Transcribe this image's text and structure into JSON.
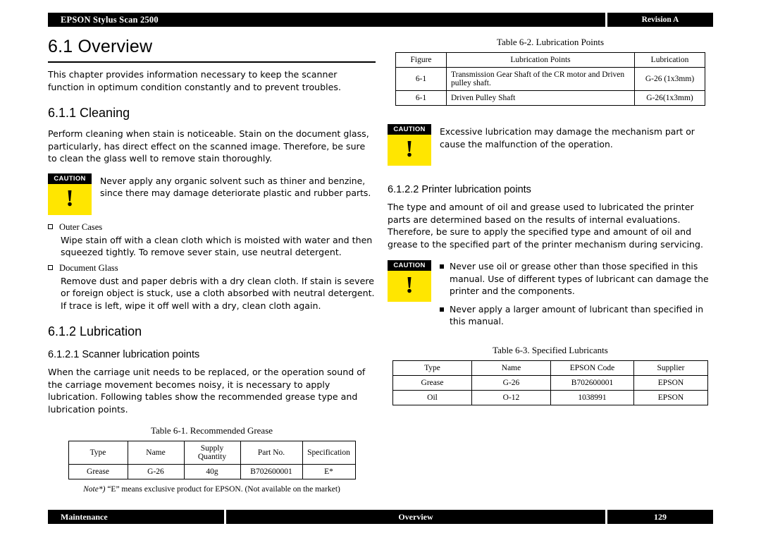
{
  "header": {
    "product": "EPSON Stylus Scan 2500",
    "revision": "Revision A"
  },
  "footer": {
    "left": "Maintenance",
    "center": "Overview",
    "page": "129"
  },
  "left_column": {
    "chapter_title": "6.1 Overview",
    "intro": "This chapter provides information necessary to keep the scanner function in optimum condition constantly and to prevent troubles.",
    "cleaning_heading": "6.1.1 Cleaning",
    "cleaning_body": "Perform cleaning when stain is noticeable. Stain on the document glass, particularly, has direct effect on the scanned image. Therefore, be sure to clean the glass well to remove stain thoroughly.",
    "caution_label": "CAUTION",
    "caution_text": "Never apply any organic solvent such as thiner and benzine, since there may damage deteriorate plastic and rubber parts.",
    "items": [
      {
        "title": "Outer Cases",
        "body": "Wipe stain off with a clean cloth which is moisted with water and then squeezed tightly. To remove sever stain, use neutral detergent."
      },
      {
        "title": "Document Glass",
        "body": "Remove dust and paper debris with a dry clean cloth. If stain is severe or foreign object is stuck, use a cloth absorbed with neutral detergent. If trace is left, wipe it off well with a dry, clean cloth again."
      }
    ],
    "lubrication_heading": "6.1.2 Lubrication",
    "scanner_lub_heading": "6.1.2.1 Scanner lubrication points",
    "scanner_lub_body": "When the carriage unit needs to be replaced, or the operation sound of the carriage movement becomes noisy, it is necessary to apply lubrication. Following tables show the recommended grease type and lubrication points.",
    "table1": {
      "caption": "Table 6-1.  Recommended Grease",
      "columns": [
        "Type",
        "Name",
        "Supply Quantity",
        "Part No.",
        "Specification"
      ],
      "rows": [
        [
          "Grease",
          "G-26",
          "40g",
          "B702600001",
          "E*"
        ]
      ],
      "note_prefix": "Note*)",
      "note_text": " “E” means exclusive product for EPSON. (Not available on the market)"
    }
  },
  "right_column": {
    "table2": {
      "caption": "Table 6-2.  Lubrication Points",
      "columns": [
        "Figure",
        "Lubrication Points",
        "Lubrication"
      ],
      "rows": [
        [
          "6-1",
          "Transmission Gear Shaft of the CR motor and Driven pulley shaft.",
          "G-26 (1x3mm)"
        ],
        [
          "6-1",
          "Driven Pulley Shaft",
          "G-26(1x3mm)"
        ]
      ]
    },
    "caution1": {
      "label": "CAUTION",
      "text": "Excessive lubrication may damage the mechanism part or cause the malfunction of the operation."
    },
    "printer_lub_heading": "6.1.2.2 Printer lubrication points",
    "printer_lub_body": "The type and amount of oil and grease used to lubricated the printer parts are determined based on the results of internal evaluations. Therefore, be sure to apply the specified type and amount of oil and grease to the specified part of the printer mechanism during servicing.",
    "caution2": {
      "label": "CAUTION",
      "bullets": [
        "Never use oil or grease other than those specified in this manual. Use of different types of lubricant can damage the printer and the components.",
        "Never apply a larger amount of lubricant than specified in this manual."
      ]
    },
    "table3": {
      "caption": "Table 6-3.  Specified Lubricants",
      "columns": [
        "Type",
        "Name",
        "EPSON Code",
        "Supplier"
      ],
      "rows": [
        [
          "Grease",
          "G-26",
          "B702600001",
          "EPSON"
        ],
        [
          "Oil",
          "O-12",
          "1038991",
          "EPSON"
        ]
      ]
    }
  },
  "colors": {
    "caution_yellow": "#ffe600",
    "bar_black": "#000000"
  }
}
